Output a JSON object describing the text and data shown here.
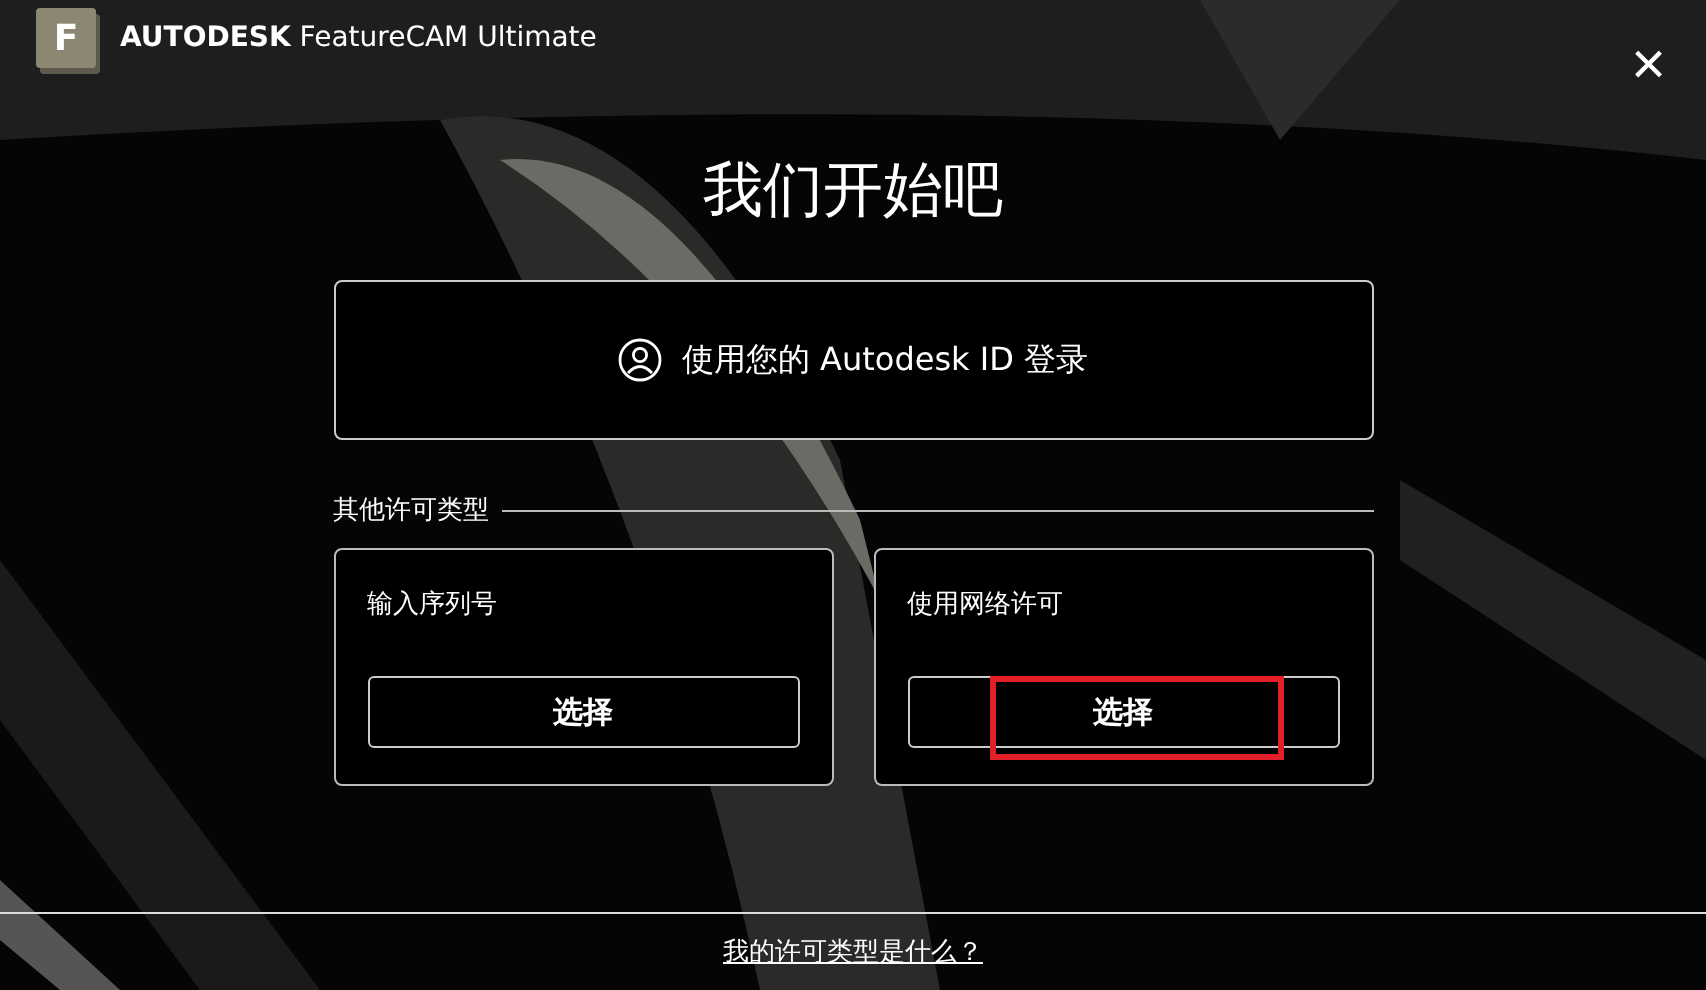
{
  "window": {
    "logo_letter": "F",
    "brand": "AUTODESK",
    "product": "FeatureCAM Ultimate",
    "close": "×"
  },
  "heading": "我们开始吧",
  "sign_in": {
    "label_start": "使用您的 ",
    "label_brand": "Autodesk ID",
    "label_end": " 登录"
  },
  "other_section": {
    "title": "其他许可类型",
    "options": [
      {
        "title": "输入序列号",
        "button": "选择",
        "highlighted": false
      },
      {
        "title": "使用网络许可",
        "button": "选择",
        "highlighted": true
      }
    ]
  },
  "footer_link": "我的许可类型是什么？"
}
